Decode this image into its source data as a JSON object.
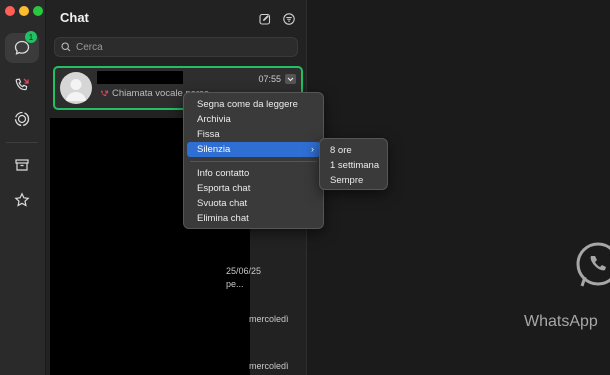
{
  "sidebar_title": "Chat",
  "unread_badge": "1",
  "search": {
    "placeholder": "Cerca"
  },
  "chat": {
    "time": "07:55",
    "preview": "Chiamata vocale persa"
  },
  "list_dates": [
    "25/06/25",
    "pe...",
    "mercoledì",
    "mercoledì"
  ],
  "context_menu": {
    "items": [
      "Segna come da leggere",
      "Archivia",
      "Fissa",
      "Silenzia",
      "Info contatto",
      "Esporta chat",
      "Svuota chat",
      "Elimina chat"
    ]
  },
  "submenu": {
    "items": [
      "8 ore",
      "1 settimana",
      "Sempre"
    ]
  },
  "brand": {
    "name": "WhatsApp"
  },
  "colors": {
    "accent_green": "#21c063",
    "menu_highlight": "#2f6ed3",
    "missed_call_red": "#e0475c"
  }
}
